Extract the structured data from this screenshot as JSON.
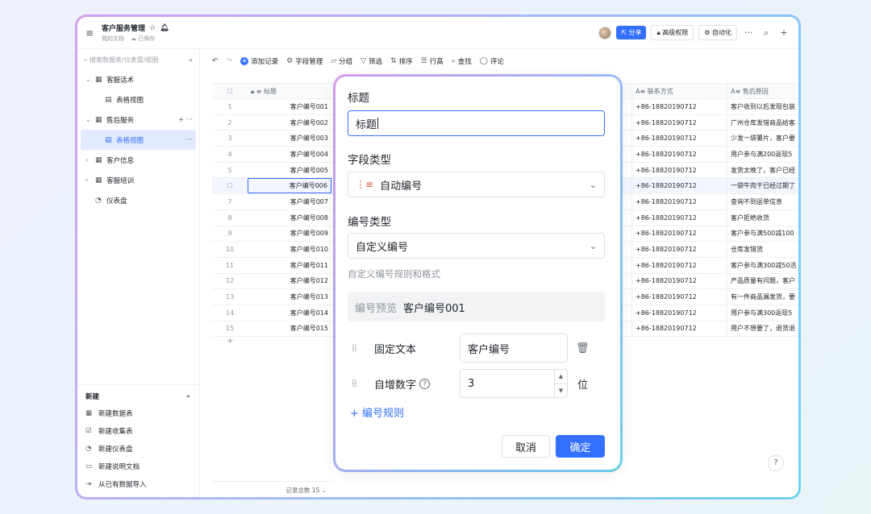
{
  "header": {
    "doc_title": "客户服务管理",
    "subtitle_left": "我的文档",
    "subtitle_right": "已保存",
    "share_label": "分享",
    "permission_label": "高级权限",
    "automation_label": "自动化"
  },
  "sidebar": {
    "search_placeholder": "搜索数据表/仪表盘/视图",
    "tree": [
      {
        "label": "客服话术",
        "level": 0,
        "expanded": true
      },
      {
        "label": "表格视图",
        "level": 1
      },
      {
        "label": "售后服务",
        "level": 0,
        "expanded": true
      },
      {
        "label": "表格视图",
        "level": 1,
        "active": true
      },
      {
        "label": "客户信息",
        "level": 0
      },
      {
        "label": "客服培训",
        "level": 0
      },
      {
        "label": "仪表盘",
        "level": 0
      }
    ],
    "new_section": {
      "title": "新建",
      "items": [
        "新建数据表",
        "新建收集表",
        "新建仪表盘",
        "新建说明文档",
        "从已有数据导入"
      ]
    }
  },
  "toolbar": {
    "add_record": "添加记录",
    "field_manage": "字段管理",
    "group": "分组",
    "filter": "筛选",
    "sort": "排序",
    "row_height": "行高",
    "find": "查找",
    "comment": "评论"
  },
  "table": {
    "columns": {
      "title": "标题",
      "contact": "联系方式",
      "reason": "售后原因"
    },
    "rows": [
      {
        "idx": "1",
        "title": "客户编号001",
        "phone": "+86-18820190712",
        "reason": "客户收到以后发现包装"
      },
      {
        "idx": "2",
        "title": "客户编号002",
        "phone": "+86-18820190712",
        "reason": "广州仓库发错商品给客"
      },
      {
        "idx": "3",
        "title": "客户编号003",
        "phone": "+86-18820190712",
        "reason": "少发一袋薯片，客户要"
      },
      {
        "idx": "4",
        "title": "客户编号004",
        "phone": "+86-18820190712",
        "reason": "用户参与满200返现5"
      },
      {
        "idx": "5",
        "title": "客户编号005",
        "phone": "+86-18820190712",
        "reason": "发货太晚了，客户已经"
      },
      {
        "idx": "",
        "title": "客户编号006",
        "phone": "+86-18820190712",
        "reason": "一袋牛肉干已经过期了"
      },
      {
        "idx": "7",
        "title": "客户编号007",
        "phone": "+86-18820190712",
        "reason": "查询不到运单信息"
      },
      {
        "idx": "8",
        "title": "客户编号008",
        "phone": "+86-18820190712",
        "reason": "客户拒绝收货"
      },
      {
        "idx": "9",
        "title": "客户编号009",
        "phone": "+86-18820190712",
        "reason": "客户参与满500减100"
      },
      {
        "idx": "10",
        "title": "客户编号010",
        "phone": "+86-18820190712",
        "reason": "仓库发错货"
      },
      {
        "idx": "11",
        "title": "客户编号011",
        "phone": "+86-18820190712",
        "reason": "客户参与满300减50活"
      },
      {
        "idx": "12",
        "title": "客户编号012",
        "phone": "+86-18820190712",
        "reason": "产品质量有问题，客户"
      },
      {
        "idx": "13",
        "title": "客户编号013",
        "phone": "+86-18820190712",
        "reason": "有一件商品漏发货，要"
      },
      {
        "idx": "14",
        "title": "客户编号014",
        "phone": "+86-18820190712",
        "reason": "用户参与满300返现5"
      },
      {
        "idx": "15",
        "title": "客户编号015",
        "phone": "+86-18820190712",
        "reason": "用户不想要了，退货退"
      }
    ],
    "footer_count": "记录总数 15"
  },
  "dialog": {
    "title_label": "标题",
    "title_value": "标题",
    "field_type_label": "字段类型",
    "field_type_value": "自动编号",
    "number_type_label": "编号类型",
    "number_type_value": "自定义编号",
    "hint": "自定义编号规则和格式",
    "preview_label": "编号预览",
    "preview_value": "客户编号001",
    "rule1_name": "固定文本",
    "rule1_value": "客户编号",
    "rule2_name": "自增数字",
    "rule2_value": "3",
    "rule2_unit": "位",
    "add_rule": "编号规则",
    "cancel": "取消",
    "ok": "确定"
  },
  "icons": {
    "accent": "#3370ff",
    "field_type_icon": "auto-number-icon"
  }
}
